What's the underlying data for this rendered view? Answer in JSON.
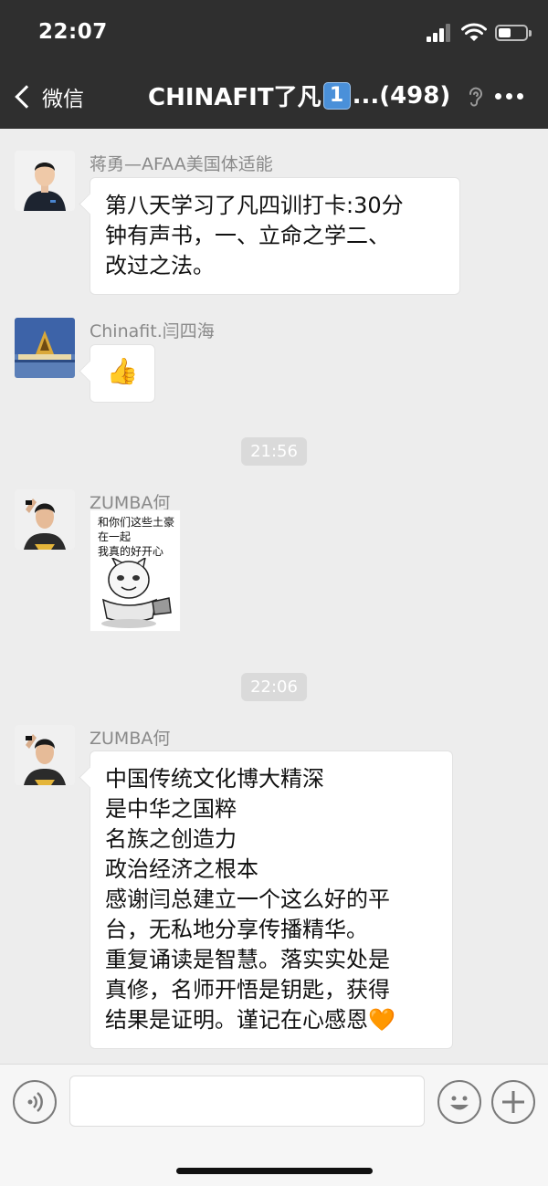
{
  "status_bar": {
    "time": "22:07"
  },
  "nav": {
    "back_label": "微信",
    "title_prefix": "CHINAFIT了凡",
    "title_badge": "1",
    "title_suffix": "...(498)"
  },
  "messages": [
    {
      "sender": "蒋勇—AFAA美国体适能",
      "text_lines": [
        "第八天学习了凡四训打卡:30分",
        "钟有声书，一、立命之学二、",
        "改过之法。"
      ]
    },
    {
      "sender": "Chinafit.闫四海",
      "emoji": "👍"
    },
    {
      "timestamp": "21:56"
    },
    {
      "sender": "ZUMBA何",
      "sticker_lines": [
        "和你们这些土豪",
        "在一起",
        "我真的好开心"
      ]
    },
    {
      "timestamp": "22:06"
    },
    {
      "sender": "ZUMBA何",
      "text_lines": [
        "中国传统文化博大精深",
        "是中华之国粹",
        "名族之创造力",
        "政治经济之根本",
        "感谢闫总建立一个这么好的平",
        "台，无私地分享传播精华。",
        "重复诵读是智慧。落实实处是",
        "真修，名师开悟是钥匙，获得",
        "结果是证明。谨记在心感恩🧡"
      ]
    }
  ],
  "input_bar": {
    "voice_icon": "voice-icon",
    "emoji_icon": "emoji-icon",
    "plus_icon": "plus-icon"
  },
  "colors": {
    "nav_bg": "#2f2f2f",
    "chat_bg": "#ededed",
    "bubble_bg": "#ffffff",
    "timestamp_bg": "#dadada"
  }
}
